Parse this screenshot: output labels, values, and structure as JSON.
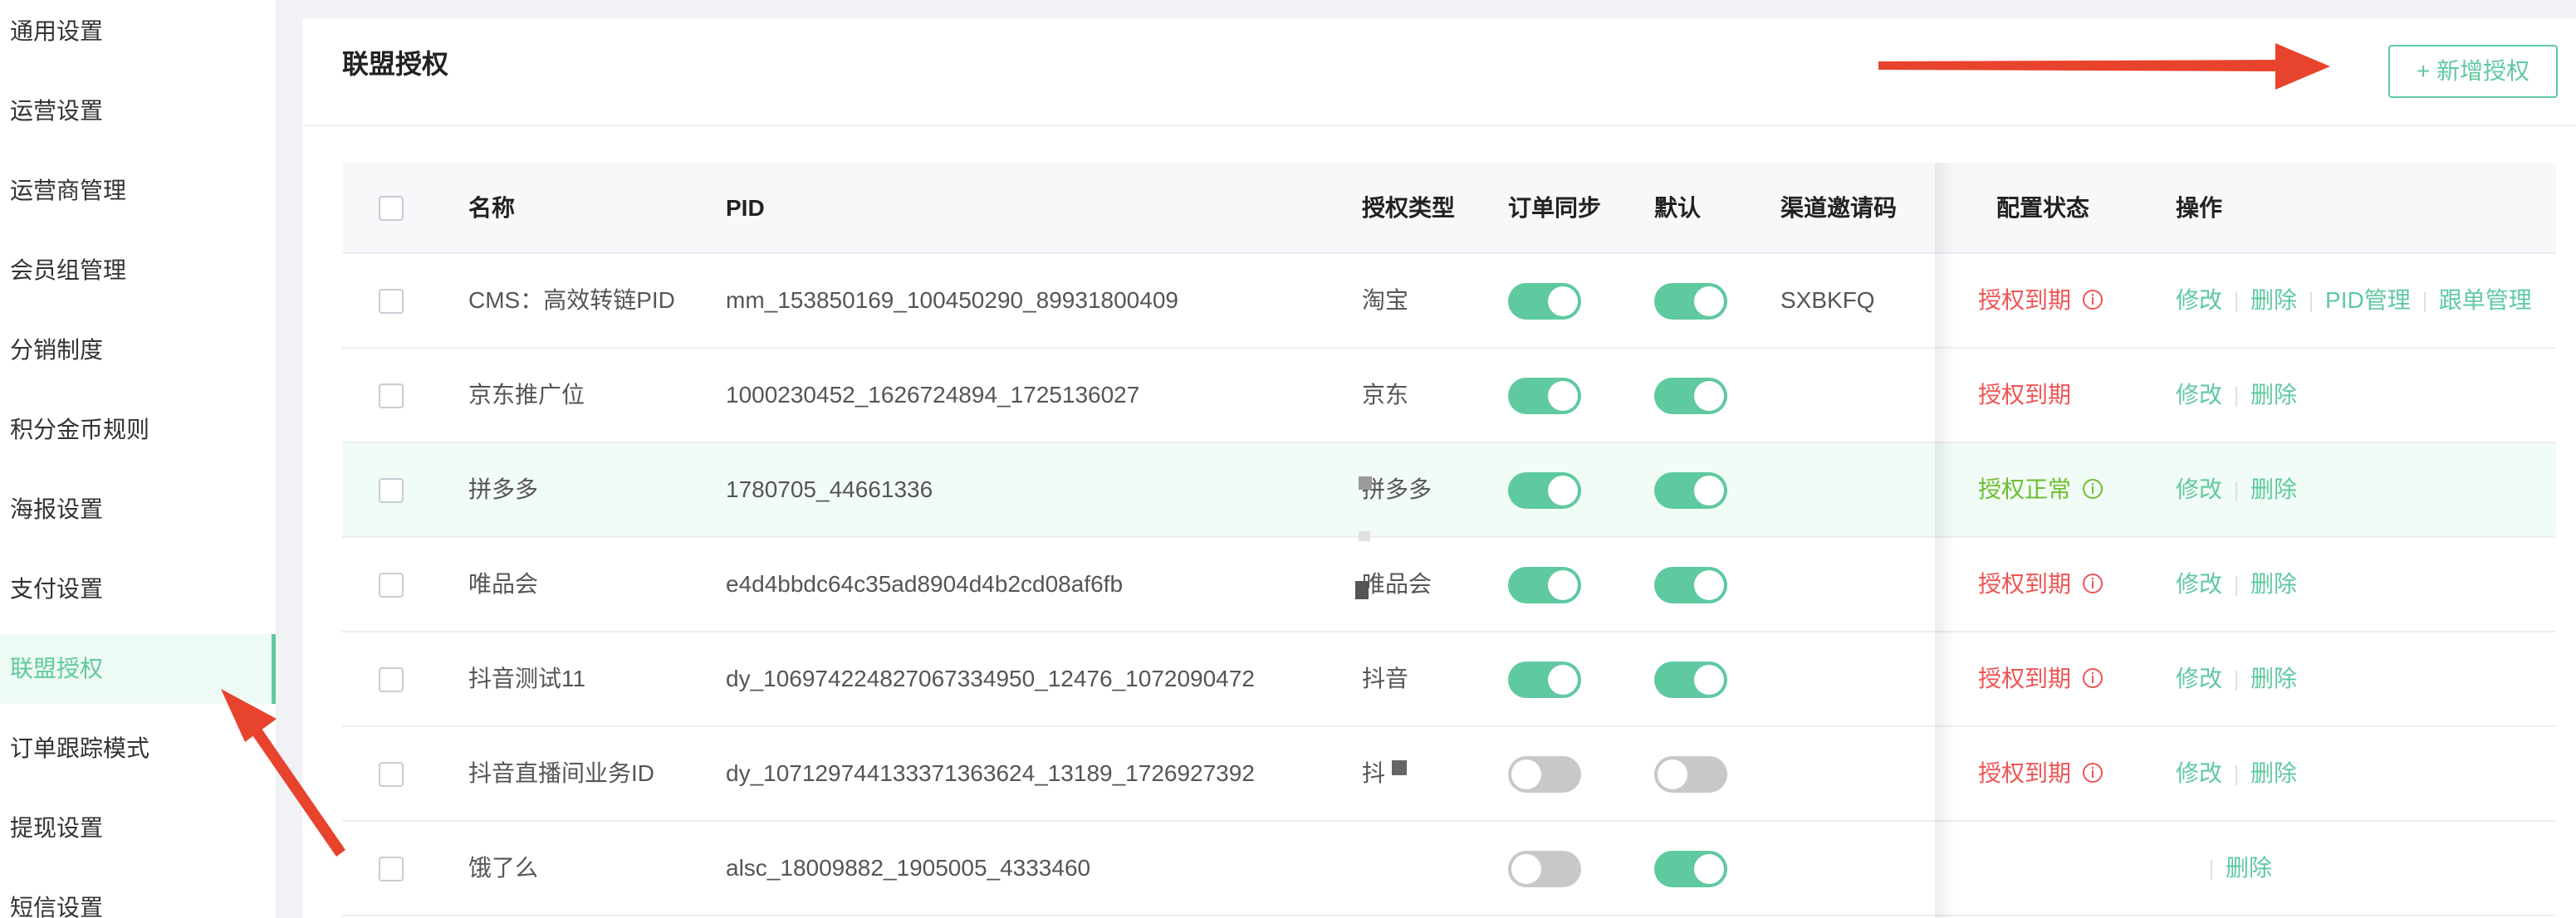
{
  "sidebar": {
    "items": [
      {
        "label": "通用设置"
      },
      {
        "label": "运营设置"
      },
      {
        "label": "运营商管理"
      },
      {
        "label": "会员组管理"
      },
      {
        "label": "分销制度"
      },
      {
        "label": "积分金币规则"
      },
      {
        "label": "海报设置"
      },
      {
        "label": "支付设置"
      },
      {
        "label": "联盟授权",
        "active": true
      },
      {
        "label": "订单跟踪模式"
      },
      {
        "label": "提现设置"
      },
      {
        "label": "短信设置"
      }
    ]
  },
  "header": {
    "title": "联盟授权",
    "add_button": "+ 新增授权"
  },
  "table": {
    "columns": {
      "name": "名称",
      "pid": "PID",
      "auth_type": "授权类型",
      "order_sync": "订单同步",
      "default": "默认",
      "invite_code": "渠道邀请码",
      "config_status": "配置状态",
      "actions": "操作"
    },
    "rows": [
      {
        "name": "CMS：高效转链PID",
        "pid": "mm_153850169_100450290_89931800409",
        "auth_type": "淘宝",
        "order_sync": true,
        "default": true,
        "invite_code": "SXBKFQ",
        "status": "授权到期",
        "status_ok": false,
        "status_icon": true,
        "edit": "修改",
        "delete": "删除",
        "extra1": "PID管理",
        "extra2": "跟单管理"
      },
      {
        "name": "京东推广位",
        "pid": "1000230452_1626724894_1725136027",
        "auth_type": "京东",
        "order_sync": true,
        "default": true,
        "invite_code": "",
        "status": "授权到期",
        "status_ok": false,
        "status_icon": false,
        "edit": "修改",
        "delete": "删除"
      },
      {
        "name": "拼多多",
        "pid": "1780705_44661336",
        "auth_type": "拼多多",
        "order_sync": true,
        "default": true,
        "invite_code": "",
        "status": "授权正常",
        "status_ok": true,
        "status_icon": true,
        "edit": "修改",
        "delete": "删除"
      },
      {
        "name": "唯品会",
        "pid": "e4d4bbdc64c35ad8904d4b2cd08af6fb",
        "auth_type": "唯品会",
        "order_sync": true,
        "default": true,
        "invite_code": "",
        "status": "授权到期",
        "status_ok": false,
        "status_icon": true,
        "edit": "修改",
        "delete": "删除"
      },
      {
        "name": "抖音测试11",
        "pid": "dy_106974224827067334950_12476_1072090472",
        "auth_type": "抖音",
        "order_sync": true,
        "default": true,
        "invite_code": "",
        "status": "授权到期",
        "status_ok": false,
        "status_icon": true,
        "edit": "修改",
        "delete": "删除"
      },
      {
        "name": "抖音直播间业务ID",
        "pid": "dy_107129744133371363624_13189_1726927392",
        "auth_type": "抖",
        "order_sync": false,
        "default": false,
        "invite_code": "",
        "status": "授权到期",
        "status_ok": false,
        "status_icon": true,
        "edit": "修改",
        "delete": "删除"
      },
      {
        "name": "饿了么",
        "pid": "alsc_18009882_1905005_4333460",
        "auth_type": "",
        "order_sync": false,
        "default": true,
        "invite_code": "",
        "status": "",
        "status_ok": false,
        "status_icon": false,
        "edit": "",
        "delete": "删除"
      }
    ]
  },
  "colors": {
    "accent": "#5fc9a0",
    "status_bad": "#f05454",
    "status_ok": "#6cbf2e",
    "annotation_arrow": "#e8432d"
  }
}
